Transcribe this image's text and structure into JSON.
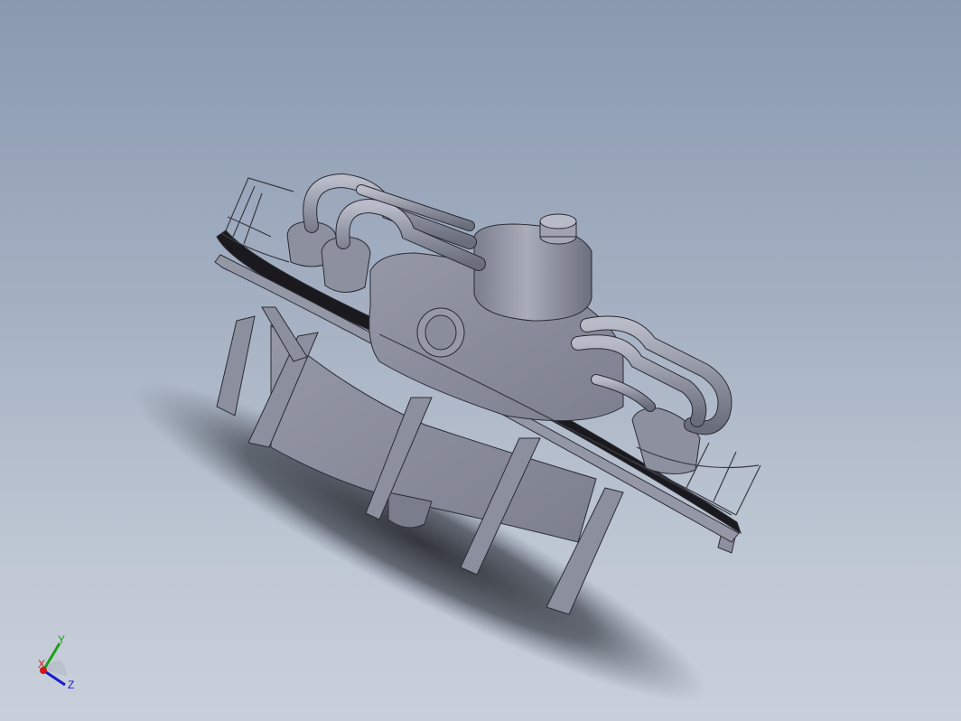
{
  "viewport": {
    "background_top": "#8a99b0",
    "background_bottom": "#c9d0db",
    "model_color": "#8e91a0",
    "model_edge_color": "#2a2b33"
  },
  "triad": {
    "x_label": "X",
    "y_label": "Y",
    "z_label": "Z",
    "x_color": "#d01818",
    "y_color": "#1aa01a",
    "z_color": "#1a1ad0"
  }
}
